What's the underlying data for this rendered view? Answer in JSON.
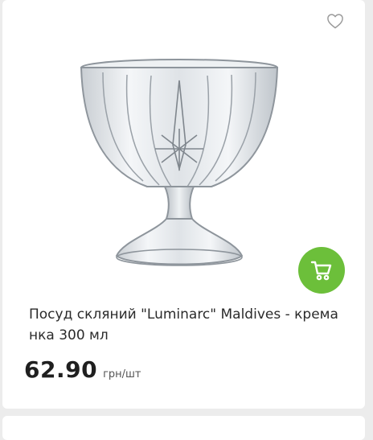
{
  "product": {
    "title": "Посуд скляний \"Luminarc\" Maldives - кремa нка 300 мл",
    "price": "62.90",
    "unit": "грн/шт",
    "image_icon": "glass-dessert-bowl",
    "favorite_icon": "heart-outline-icon",
    "cart_icon": "cart-icon"
  },
  "colors": {
    "accent": "#6cbf3a",
    "text": "#2b2b2b",
    "background": "#ececec"
  }
}
